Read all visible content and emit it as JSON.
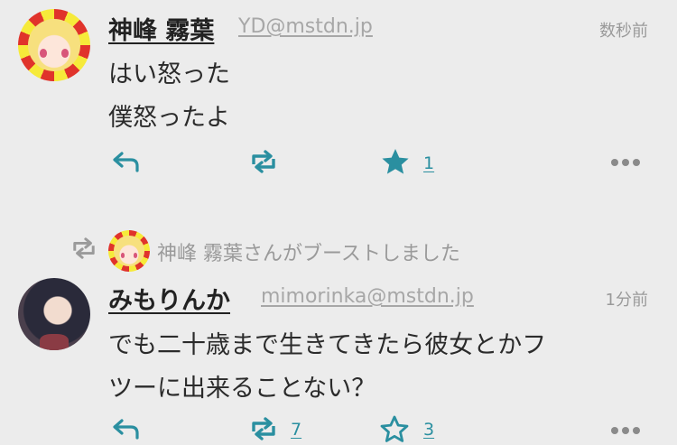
{
  "posts": [
    {
      "display_name": "神峰 霧葉",
      "handle": "YD@mstdn.jp",
      "time": "数秒前",
      "lines": [
        "はい怒った",
        "僕怒ったよ"
      ],
      "favourite_count": "1"
    },
    {
      "boosted_by_text": "神峰 霧葉さんがブーストしました",
      "display_name": "みもりんか",
      "handle": "mimorinka@mstdn.jp",
      "time": "1分前",
      "lines": [
        "でも二十歳まで生きてきたら彼女とかフ",
        "ツーに出来ることない？"
      ],
      "boost_count": "7",
      "favourite_count": "3"
    }
  ],
  "colors": {
    "accent": "#2a8fa0",
    "text": "#2b2b2b",
    "muted": "#9a9a9a",
    "background": "#ececec"
  }
}
